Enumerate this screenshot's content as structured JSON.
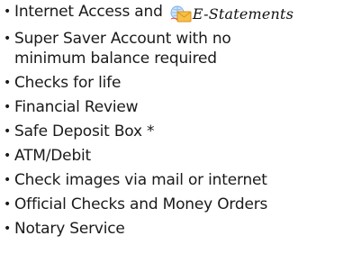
{
  "benefits": [
    {
      "text": "Internet Access and ",
      "logo_text": "E-Statements",
      "logo_icon": "envelope-globe-icon"
    },
    {
      "text": "Super Saver Account with no",
      "text2": "minimum balance required"
    },
    {
      "text": "Checks for life"
    },
    {
      "text": "Financial Review"
    },
    {
      "text": "Safe Deposit Box *"
    },
    {
      "text": "ATM/Debit"
    },
    {
      "text": "Check images via mail or internet"
    },
    {
      "text": "Official Checks and Money Orders"
    },
    {
      "text": "Notary Service"
    }
  ],
  "colors": {
    "text": "#1a1a1a",
    "logo_envelope": "#f3b73a",
    "logo_globe": "#7db0e8"
  }
}
